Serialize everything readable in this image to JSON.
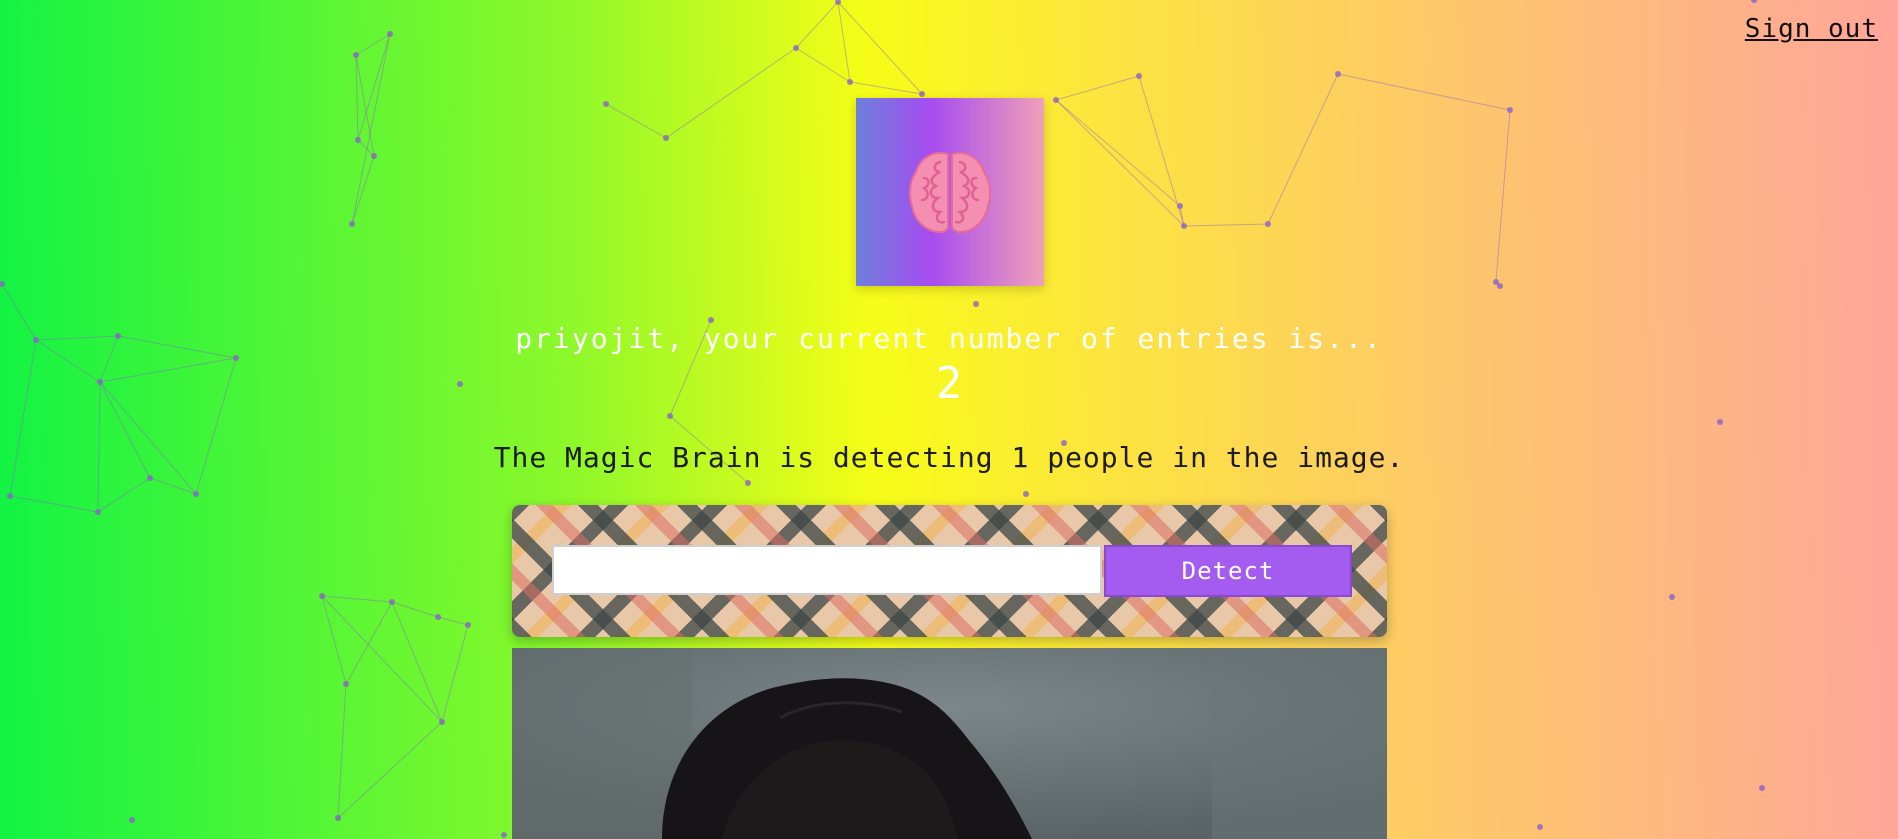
{
  "nav": {
    "sign_out_label": "Sign out"
  },
  "logo": {
    "icon": "brain-icon"
  },
  "rank": {
    "message": "priyojit, your current number of entries is...",
    "count": "2"
  },
  "detection": {
    "message": "The Magic Brain is detecting 1 people in the image."
  },
  "form": {
    "input_value": "",
    "input_placeholder": "",
    "button_label": "Detect"
  },
  "colors": {
    "button": "#a45cf0",
    "particles": "#8a63c8"
  }
}
